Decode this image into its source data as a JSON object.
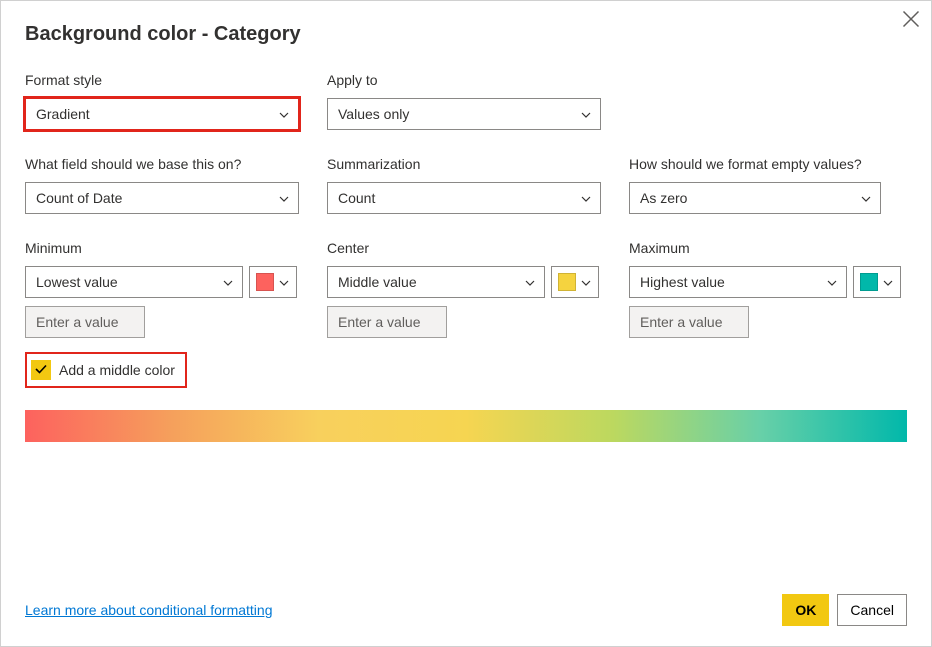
{
  "title": "Background color - Category",
  "format_style": {
    "label": "Format style",
    "value": "Gradient"
  },
  "apply_to": {
    "label": "Apply to",
    "value": "Values only"
  },
  "base_field": {
    "label": "What field should we base this on?",
    "value": "Count of Date"
  },
  "summarization": {
    "label": "Summarization",
    "value": "Count"
  },
  "empty_values": {
    "label": "How should we format empty values?",
    "value": "As zero"
  },
  "minimum": {
    "label": "Minimum",
    "mode": "Lowest value",
    "color": "#fd625e",
    "swatch_style": "background:#fd625e",
    "placeholder": "Enter a value"
  },
  "center": {
    "label": "Center",
    "mode": "Middle value",
    "color": "#f5d33f",
    "swatch_style": "background:#f5d33f",
    "placeholder": "Enter a value"
  },
  "maximum": {
    "label": "Maximum",
    "mode": "Highest value",
    "color": "#01b8aa",
    "swatch_style": "background:#01b8aa",
    "placeholder": "Enter a value"
  },
  "add_middle_color": {
    "label": "Add a middle color",
    "checked": true
  },
  "footer": {
    "learn_more": "Learn more about conditional formatting",
    "ok": "OK",
    "cancel": "Cancel"
  },
  "gradient_stops": [
    "#fd625e",
    "#f5d33f",
    "#01b8aa"
  ]
}
